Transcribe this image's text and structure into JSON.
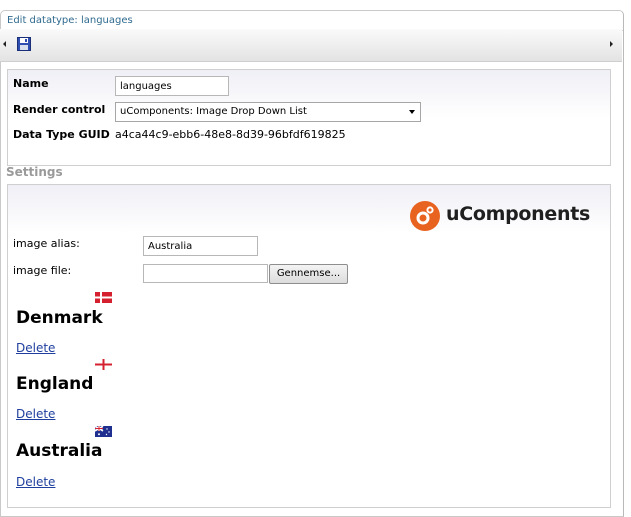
{
  "window": {
    "title": "Edit datatype: languages"
  },
  "toolbar": {
    "save_icon": "floppy-disk-save-icon"
  },
  "properties": {
    "name_label": "Name",
    "name_value": "languages",
    "render_label": "Render control",
    "render_value": "uComponents: Image Drop Down List",
    "guid_label": "Data Type GUID",
    "guid_value": "a4ca44c9-ebb6-48e8-8d39-96bfdf619825"
  },
  "settings": {
    "title": "Settings",
    "logo_text": "uComponents",
    "image_alias_label": "image alias:",
    "image_alias_value": "Australia",
    "image_file_label": "image file:",
    "image_file_value": "",
    "browse_label": "Gennemse..."
  },
  "languages": [
    {
      "name": "Denmark",
      "delete_label": "Delete",
      "flag": "denmark-flag-icon"
    },
    {
      "name": "England",
      "delete_label": "Delete",
      "flag": "england-flag-icon"
    },
    {
      "name": "Australia",
      "delete_label": "Delete",
      "flag": "australia-flag-icon"
    }
  ],
  "colors": {
    "accent": "#e86320",
    "link": "#1f3f9e",
    "title": "#2f6a8f"
  }
}
